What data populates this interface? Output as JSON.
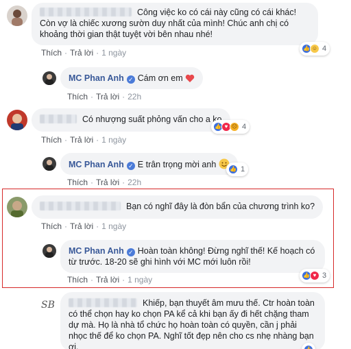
{
  "comments": [
    {
      "text": "Công việc ko có cái này cũng có cái khác! Còn vợ là chiếc xương sườn duy nhất của mình! Chúc anh chị có khoảng thời gian thật tuyệt vời bên nhau nhé!",
      "like": "Thích",
      "reply": "Trả lời",
      "time": "1 ngày",
      "reaction_count": "4"
    },
    {
      "author": "MC Phan Anh",
      "text": "Cám ơn em",
      "like": "Thích",
      "reply": "Trả lời",
      "time": "22h"
    },
    {
      "text": "Có nhượng suất phỏng vấn cho a ko",
      "like": "Thích",
      "reply": "Trả lời",
      "time": "1 ngày",
      "reaction_count": "4"
    },
    {
      "author": "MC Phan Anh",
      "text": "E trân trọng mời anh",
      "like": "Thích",
      "reply": "Trả lời",
      "time": "22h",
      "reaction_count": "1"
    },
    {
      "text": "Bạn có nghĩ đây là đòn bẩn của chương trình ko?",
      "like": "Thích",
      "reply": "Trả lời",
      "time": "1 ngày"
    },
    {
      "author": "MC Phan Anh",
      "text": "Hoàn toàn không! Đừng nghĩ thế! Kế hoạch có từ trước. 18-20 sẽ ghi hình với MC mới luôn rồi!",
      "like": "Thích",
      "reply": "Trả lời",
      "time": "1 ngày",
      "reaction_count": "3"
    },
    {
      "text": "Khiếp, bạn thuyết âm mưu thế. Ctr hoàn toàn có thể chọn hay ko chọn PA kể cả khi bạn ấy đi hết chặng tham dự mà. Họ là nhà tổ chức họ hoàn toàn có quyền, cần j phải nhọc thế để ko chọn PA. Nghĩ tốt đẹp nên cho cs nhẹ nhàng bạn ơi."
    }
  ],
  "colors": {
    "author": "#385898",
    "bubble": "#f2f3f5",
    "highlight": "#d62828"
  }
}
